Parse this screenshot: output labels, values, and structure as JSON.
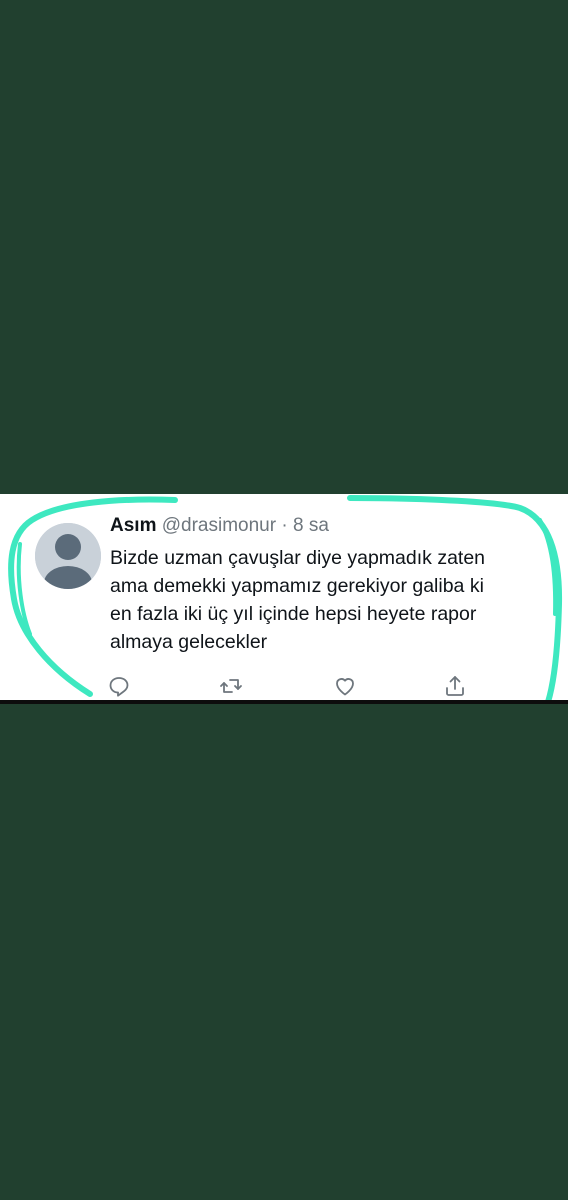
{
  "tweet": {
    "name": "Asım",
    "handle": "@drasimonur",
    "separator": "·",
    "time": "8 sa",
    "text_lines": [
      "Bizde uzman çavuşlar diye yapmadık zaten",
      "ama demekki yapmamız gerekiyor galiba ki",
      "en fazla iki üç yıl içinde hepsi heyete rapor",
      "almaya gelecekler"
    ]
  },
  "actions": {
    "reply_icon": "reply-icon",
    "retweet_icon": "retweet-icon",
    "like_icon": "heart-icon",
    "share_icon": "share-icon"
  },
  "colors": {
    "background": "#21402f",
    "card": "#ffffff",
    "highlight": "#3ee8c0",
    "secondary_text": "#6e767d",
    "primary_text": "#0f1419"
  }
}
